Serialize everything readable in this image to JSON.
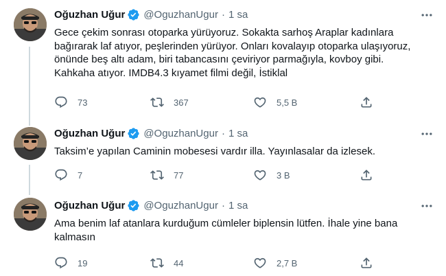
{
  "tweets": [
    {
      "name": "Oğuzhan Uğur",
      "handle": "@OguzhanUgur",
      "dot": "·",
      "time": "1 sa",
      "text": "Gece çekim sonrası otoparka yürüyoruz. Sokakta sarhoş Araplar kadınlara bağırarak laf atıyor, peşlerinden yürüyor. Onları kovalayıp otoparka ulaşıyoruz, önünde beş altı adam, biri tabancasını çeviriyor parmağıyla, kovboy gibi. Kahkaha atıyor. IMDB4.3 kıyamet filmi değil, İstiklal",
      "replies": "73",
      "retweets": "367",
      "likes": "5,5 B"
    },
    {
      "name": "Oğuzhan Uğur",
      "handle": "@OguzhanUgur",
      "dot": "·",
      "time": "1 sa",
      "text": "Taksim’e yapılan Caminin mobesesi vardır illa. Yayınlasalar da izlesek.",
      "replies": "7",
      "retweets": "77",
      "likes": "3 B"
    },
    {
      "name": "Oğuzhan Uğur",
      "handle": "@OguzhanUgur",
      "dot": "·",
      "time": "1 sa",
      "text": "Ama benim laf atanlara kurduğum cümleler biplensin lütfen. İhale yine bana kalmasın",
      "replies": "19",
      "retweets": "44",
      "likes": "2,7 B"
    }
  ],
  "icons": {
    "verified": "verified-badge-icon",
    "more": "more-options-icon",
    "reply": "reply-icon",
    "retweet": "retweet-icon",
    "like": "like-icon",
    "share": "share-icon"
  },
  "colors": {
    "verified": "#1d9bf0",
    "text": "#0f1419",
    "muted": "#536471",
    "divider": "#eff3f4",
    "thread": "#cfd9de"
  }
}
